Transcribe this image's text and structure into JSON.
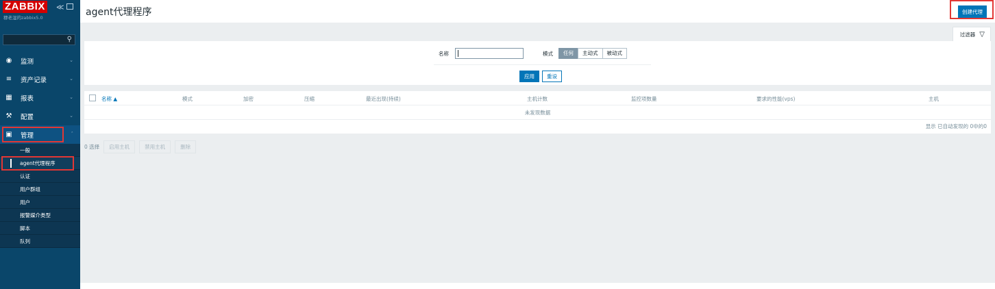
{
  "app": {
    "logo": "ZABBIX",
    "server_name": "穆老湿的zabbix5.0",
    "collapse_glyph": "≪"
  },
  "sidebar": {
    "menu": [
      {
        "label": "监测",
        "icon": "eye-icon"
      },
      {
        "label": "资产记录",
        "icon": "list-icon"
      },
      {
        "label": "报表",
        "icon": "bar-chart-icon"
      },
      {
        "label": "配置",
        "icon": "wrench-icon"
      },
      {
        "label": "管理",
        "icon": "admin-icon"
      }
    ],
    "submenu": [
      {
        "label": "一般"
      },
      {
        "label": "agent代理程序"
      },
      {
        "label": "认证"
      },
      {
        "label": "用户群组"
      },
      {
        "label": "用户"
      },
      {
        "label": "报警媒介类型"
      },
      {
        "label": "脚本"
      },
      {
        "label": "队列"
      }
    ]
  },
  "header": {
    "title": "agent代理程序",
    "create_label": "创建代理"
  },
  "filter": {
    "tab_label": "过滤器",
    "name_label": "名称",
    "name_value": "",
    "mode_label": "模式",
    "mode_options": [
      "任何",
      "主动式",
      "被动式"
    ],
    "mode_selected": "任何",
    "apply_label": "应用",
    "reset_label": "重设"
  },
  "table": {
    "columns": [
      "名称 ▲",
      "模式",
      "加密",
      "压缩",
      "最近出现(持续)",
      "主机计数",
      "监控项数量",
      "要求的性能(vps)",
      "主机"
    ],
    "empty_text": "未发现数据",
    "footer_text": "显示 已自动发现的 0中的0"
  },
  "actions": {
    "selected_count": "0 选择",
    "buttons": [
      "启用主机",
      "禁用主机",
      "删除"
    ]
  },
  "colors": {
    "sidebar_bg": "#0a466a",
    "accent": "#0275b8",
    "logo_bg": "#d40000",
    "highlight": "#e33734"
  }
}
